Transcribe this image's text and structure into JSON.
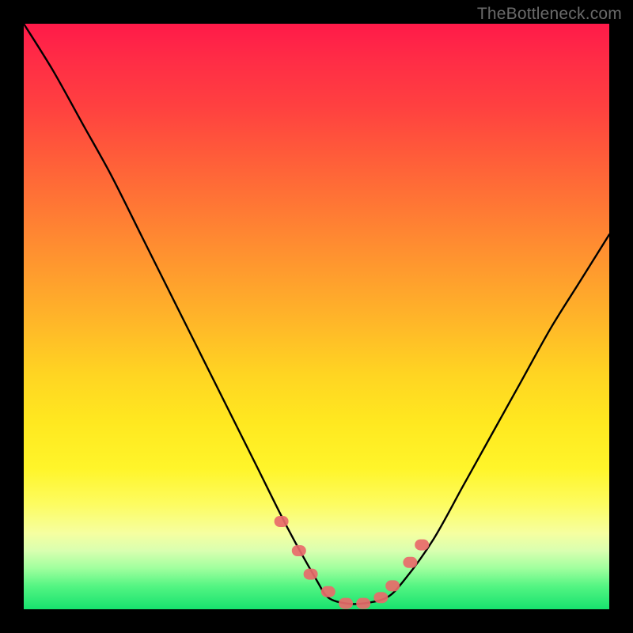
{
  "watermark": "TheBottleneck.com",
  "colors": {
    "background": "#000000",
    "curve": "#000000",
    "marker": "#e86a6a",
    "gradient_top": "#ff1a49",
    "gradient_bottom": "#17e26e"
  },
  "chart_data": {
    "type": "line",
    "title": "",
    "xlabel": "",
    "ylabel": "",
    "xlim": [
      0,
      100
    ],
    "ylim": [
      0,
      100
    ],
    "grid": false,
    "series": [
      {
        "name": "bottleneck-curve",
        "x": [
          0,
          5,
          10,
          15,
          20,
          25,
          30,
          35,
          40,
          45,
          50,
          52,
          55,
          58,
          62,
          65,
          70,
          75,
          80,
          85,
          90,
          95,
          100
        ],
        "values": [
          100,
          92,
          83,
          74,
          64,
          54,
          44,
          34,
          24,
          14,
          5,
          2,
          1,
          1,
          2,
          5,
          12,
          21,
          30,
          39,
          48,
          56,
          64
        ]
      }
    ],
    "markers": {
      "name": "highlighted-range",
      "x": [
        44,
        47,
        49,
        52,
        55,
        58,
        61,
        63,
        66,
        68
      ],
      "values": [
        15,
        10,
        6,
        3,
        1,
        1,
        2,
        4,
        8,
        11
      ]
    }
  }
}
